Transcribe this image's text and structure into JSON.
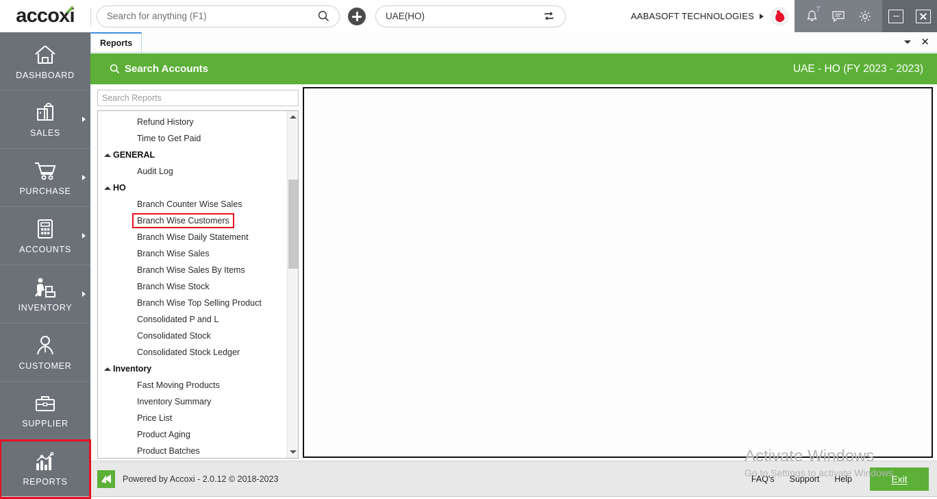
{
  "app": {
    "logo_text": "accoxi"
  },
  "header": {
    "search_placeholder": "Search for anything (F1)",
    "search_value": "",
    "search_icon": "search-icon",
    "add_icon": "plus-icon",
    "branch_value": "UAE(HO)",
    "branch_switch_icon": "sync-swap-icon",
    "company_name": "AABASOFT TECHNOLOGIES",
    "avatar_icon": "user-avatar-logo",
    "notification_icon": "bell-icon",
    "notification_badge": "7",
    "message_icon": "message-icon",
    "settings_icon": "gear-icon",
    "minimize_label": "minimize-icon",
    "close_label": "close-icon"
  },
  "sidebar": {
    "items": [
      {
        "label": "DASHBOARD",
        "icon": "home-icon",
        "has_arrow": false,
        "highlighted": false
      },
      {
        "label": "SALES",
        "icon": "shopping-bag-icon",
        "has_arrow": true,
        "highlighted": false
      },
      {
        "label": "PURCHASE",
        "icon": "shopping-cart-icon",
        "has_arrow": true,
        "highlighted": false
      },
      {
        "label": "ACCOUNTS",
        "icon": "calculator-icon",
        "has_arrow": true,
        "highlighted": false
      },
      {
        "label": "INVENTORY",
        "icon": "warehouse-worker-icon",
        "has_arrow": true,
        "highlighted": false
      },
      {
        "label": "CUSTOMER",
        "icon": "person-icon",
        "has_arrow": false,
        "highlighted": false
      },
      {
        "label": "SUPPLIER",
        "icon": "briefcase-icon",
        "has_arrow": false,
        "highlighted": false
      },
      {
        "label": "REPORTS",
        "icon": "bar-chart-icon",
        "has_arrow": false,
        "highlighted": true
      }
    ]
  },
  "tabs": {
    "items": [
      {
        "label": "Reports",
        "active": true
      }
    ],
    "dropdown_icon": "chevron-down-icon",
    "close_icon": "close-icon"
  },
  "page_header": {
    "title": "Search Accounts",
    "search_icon": "search-icon",
    "context": "UAE - HO (FY 2023 - 2023)"
  },
  "reports": {
    "search_placeholder": "Search Reports",
    "search_value": "",
    "list": [
      {
        "label": "Refund History",
        "type": "item",
        "selected": false
      },
      {
        "label": "Time to Get Paid",
        "type": "item",
        "selected": false
      },
      {
        "label": "GENERAL",
        "type": "group",
        "selected": false
      },
      {
        "label": "Audit Log",
        "type": "item",
        "selected": false
      },
      {
        "label": "HO",
        "type": "group",
        "selected": false
      },
      {
        "label": "Branch Counter Wise Sales",
        "type": "item",
        "selected": false
      },
      {
        "label": "Branch Wise Customers",
        "type": "item",
        "selected": true
      },
      {
        "label": "Branch Wise Daily Statement",
        "type": "item",
        "selected": false
      },
      {
        "label": "Branch Wise Sales",
        "type": "item",
        "selected": false
      },
      {
        "label": "Branch Wise Sales By Items",
        "type": "item",
        "selected": false
      },
      {
        "label": "Branch Wise Stock",
        "type": "item",
        "selected": false
      },
      {
        "label": "Branch Wise Top Selling Product",
        "type": "item",
        "selected": false
      },
      {
        "label": "Consolidated P and L",
        "type": "item",
        "selected": false
      },
      {
        "label": "Consolidated Stock",
        "type": "item",
        "selected": false
      },
      {
        "label": "Consolidated Stock Ledger",
        "type": "item",
        "selected": false
      },
      {
        "label": "Inventory",
        "type": "group",
        "selected": false
      },
      {
        "label": "Fast Moving Products",
        "type": "item",
        "selected": false
      },
      {
        "label": "Inventory Summary",
        "type": "item",
        "selected": false
      },
      {
        "label": "Price List",
        "type": "item",
        "selected": false
      },
      {
        "label": "Product Aging",
        "type": "item",
        "selected": false
      },
      {
        "label": "Product Batches",
        "type": "item",
        "selected": false
      }
    ],
    "scroll_up_icon": "caret-up-icon",
    "scroll_down_icon": "caret-down-icon"
  },
  "watermark": {
    "title": "Activate Windows",
    "subtitle": "Go to Settings to activate Windows."
  },
  "footer": {
    "logo_icon": "accoxi-arrow-logo",
    "powered_by": "Powered by Accoxi - 2.0.12 © 2018-2023",
    "links": [
      "FAQ's",
      "Support",
      "Help"
    ],
    "exit_label": "Exit"
  },
  "colors": {
    "brand_green": "#5cb037",
    "sidebar_gray": "#6b7177",
    "highlight_red": "#e81123",
    "tab_accent_blue": "#3c8dde"
  }
}
